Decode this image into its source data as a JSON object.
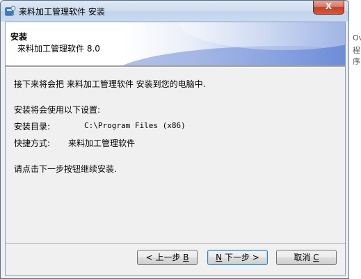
{
  "window": {
    "title": "来料加工管理软件 安装",
    "close_label": "X"
  },
  "banner": {
    "title": "安装",
    "subtitle": "来料加工管理软件 8.0"
  },
  "content": {
    "intro": "接下来将会把 来料加工管理软件 安装到您的电脑中.",
    "settings_heading": "安装将会使用以下设置:",
    "install_dir_label": "安装目录:",
    "install_dir_value": "C:\\Program Files (x86)",
    "shortcut_label": "快捷方式:",
    "shortcut_value": "来料加工管理软件",
    "prompt": "请点击下一步按钮继续安装."
  },
  "buttons": {
    "back": {
      "prefix": "< 上一步 ",
      "key": "B"
    },
    "next": {
      "key": "N",
      "suffix": " 下一步 >"
    },
    "cancel": {
      "prefix": "取消 ",
      "key": "C"
    }
  },
  "background_fragments": [
    "Ov",
    "程序"
  ],
  "colors": {
    "banner_accent": "#6e8ed8",
    "close_button": "#c4412a",
    "default_button_border": "#3c7fb1"
  }
}
